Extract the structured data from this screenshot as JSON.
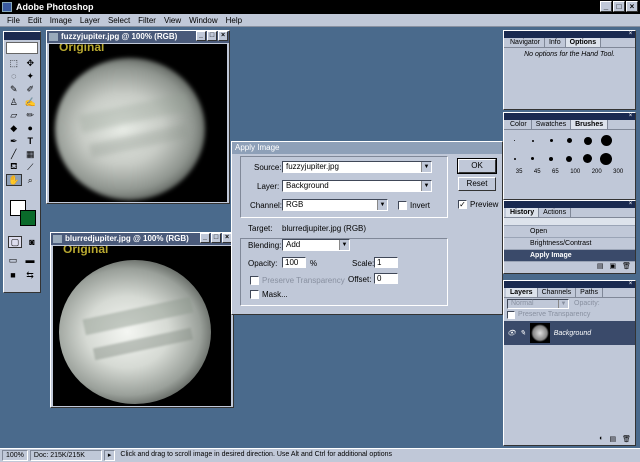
{
  "app": {
    "title": "Adobe Photoshop"
  },
  "menu": [
    "File",
    "Edit",
    "Image",
    "Layer",
    "Select",
    "Filter",
    "View",
    "Window",
    "Help"
  ],
  "documents": [
    {
      "title": "fuzzyjupiter.jpg @ 100% (RGB)",
      "watermark": "Original"
    },
    {
      "title": "blurredjupiter.jpg @ 100% (RGB)",
      "watermark": "Original"
    }
  ],
  "dialog": {
    "title": "Apply Image",
    "source_label": "Source:",
    "source_value": "fuzzyjupiter.jpg",
    "layer_label": "Layer:",
    "layer_value": "Background",
    "channel_label": "Channel:",
    "channel_value": "RGB",
    "invert_label": "Invert",
    "target_label": "Target:",
    "target_value": "blurredjupiter.jpg (RGB)",
    "blending_label": "Blending:",
    "blending_value": "Add",
    "opacity_label": "Opacity:",
    "opacity_value": "100",
    "opacity_unit": "%",
    "scale_label": "Scale:",
    "scale_value": "1",
    "offset_label": "Offset:",
    "offset_value": "0",
    "preserve_label": "Preserve Transparency",
    "mask_label": "Mask...",
    "ok": "OK",
    "reset": "Reset",
    "preview": "Preview"
  },
  "navigator": {
    "tabs": [
      "Navigator",
      "Info",
      "Options"
    ],
    "message": "No options for the Hand Tool."
  },
  "brushes": {
    "tabs": [
      "Color",
      "Swatches",
      "Brushes"
    ],
    "labels": [
      "35",
      "45",
      "65",
      "100",
      "200",
      "300"
    ]
  },
  "history": {
    "tabs": [
      "History",
      "Actions"
    ],
    "items": [
      "Open",
      "Brightness/Contrast",
      "Apply Image"
    ]
  },
  "layers": {
    "tabs": [
      "Layers",
      "Channels",
      "Paths"
    ],
    "blend_mode": "Normal",
    "opacity_label": "Opacity:",
    "preserve_label": "Preserve Transparency",
    "layer_name": "Background"
  },
  "status": {
    "zoom": "100%",
    "doc": "Doc: 215K/215K",
    "hint": "Click and drag to scroll image in desired direction.  Use Alt and Ctrl for additional options"
  }
}
